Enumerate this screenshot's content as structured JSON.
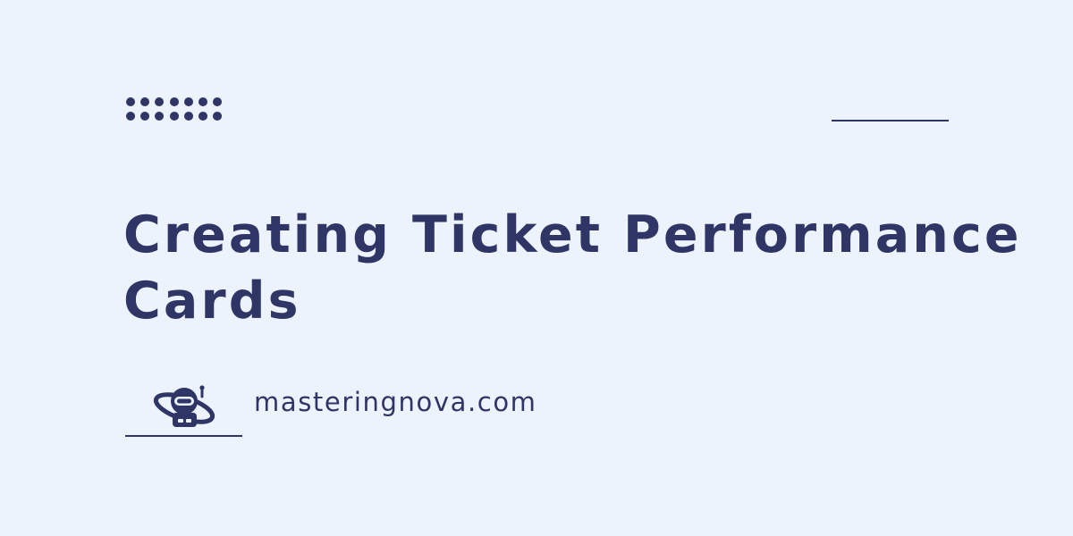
{
  "title": "Creating Ticket Performance Cards",
  "brand": {
    "site": "masteringnova.com",
    "logo_icon": "astronaut-icon"
  },
  "decor": {
    "dot_grid_icon": "dot-grid-icon",
    "dot_columns": 7,
    "dot_rows": 2
  },
  "colors": {
    "background": "#edf3fd",
    "accent": "#2f3565"
  }
}
